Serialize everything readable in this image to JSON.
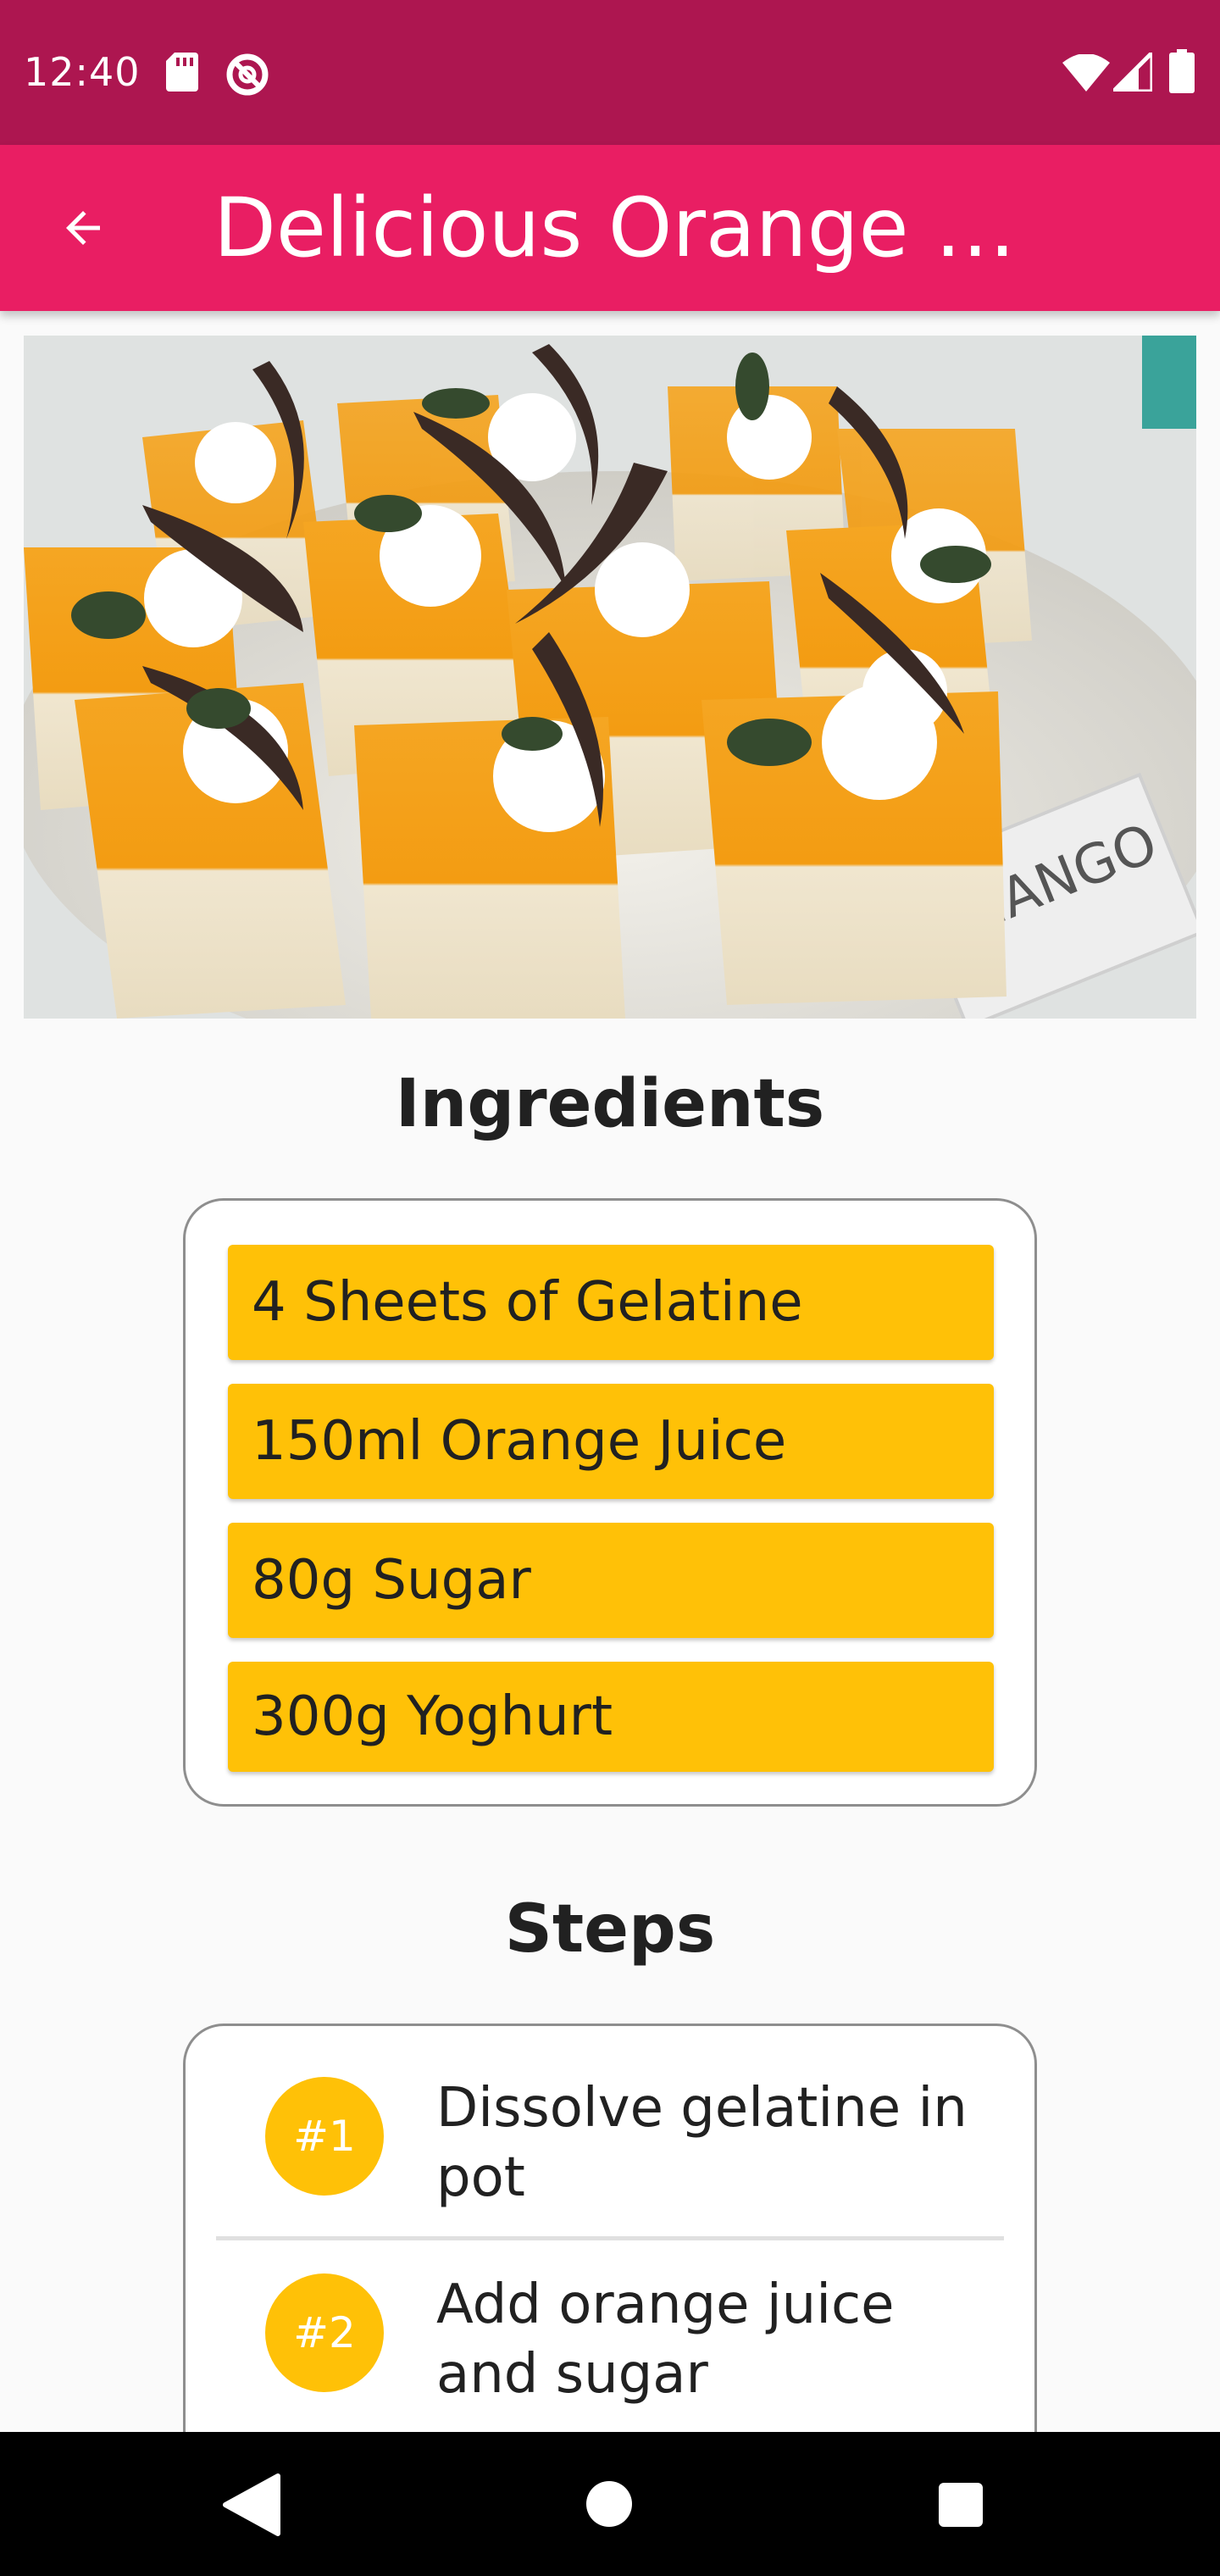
{
  "status_bar": {
    "time": "12:40",
    "icons": [
      "sd-card-icon",
      "do-not-disturb-icon",
      "wifi-icon",
      "signal-icon",
      "battery-icon"
    ]
  },
  "app_bar": {
    "title": "Delicious Orange …",
    "back_icon": "arrow-back-icon"
  },
  "hero": {
    "image_subject": "orange mousse dessert cups with chocolate and whipped cream",
    "sign_text": "MANGO"
  },
  "ingredients": {
    "title": "Ingredients",
    "items": [
      "4 Sheets of Gelatine",
      "150ml Orange Juice",
      "80g Sugar",
      "300g Yoghurt"
    ]
  },
  "steps": {
    "title": "Steps",
    "items": [
      {
        "badge": "#1",
        "text": "Dissolve gelatine in pot"
      },
      {
        "badge": "#2",
        "text": "Add orange juice and sugar"
      }
    ]
  },
  "nav_bar": {
    "icons": [
      "nav-back-icon",
      "nav-home-icon",
      "nav-recents-icon"
    ]
  },
  "colors": {
    "status_bar": "#ad1650",
    "app_bar": "#e91e63",
    "accent": "#ffc107",
    "background": "#fafafa"
  }
}
